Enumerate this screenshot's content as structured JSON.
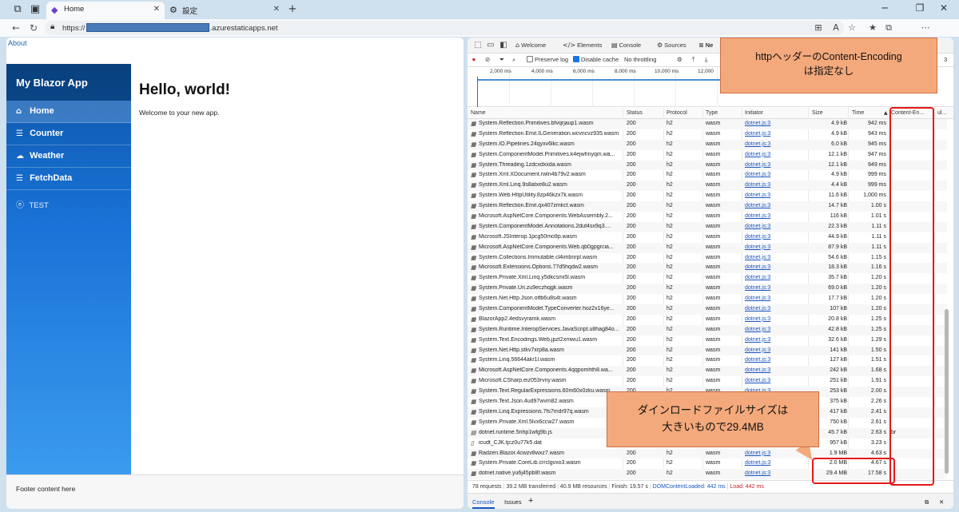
{
  "browser": {
    "tabs": [
      {
        "label": "Home",
        "icon": "blazor-icon"
      },
      {
        "label": "設定",
        "icon": "gear-icon"
      }
    ],
    "url_prefix": "https://",
    "url_suffix": ".azurestaticapps.net"
  },
  "app": {
    "about_link": "About",
    "brand": "My Blazor App",
    "nav": [
      {
        "label": "Home",
        "icon": "home-icon"
      },
      {
        "label": "Counter",
        "icon": "list-icon"
      },
      {
        "label": "Weather",
        "icon": "cloud-icon"
      },
      {
        "label": "FetchData",
        "icon": "list-icon"
      },
      {
        "label": "TEST",
        "icon": "circle-e-icon"
      }
    ],
    "heading": "Hello, world!",
    "welcome": "Welcome to your new app.",
    "footer": "Footer content here"
  },
  "devtools": {
    "tabs": [
      "Welcome",
      "Elements",
      "Console",
      "Sources",
      "Ne"
    ],
    "toolbar": {
      "preserve_log": "Preserve log",
      "disable_cache": "Disable cache",
      "throttling": "No throttling",
      "number": "3"
    },
    "timeline_ticks": [
      "2,000 ms",
      "4,000 ms",
      "6,000 ms",
      "8,000 ms",
      "10,000 ms",
      "12,000"
    ],
    "columns": [
      "Name",
      "Status",
      "Protocol",
      "Type",
      "Initiator",
      "Size",
      "Time",
      "Content-En...",
      "ul..."
    ],
    "rows": [
      {
        "name": "System.Reflection.Primitives.bfvqrjaup1.wasm",
        "status": "200",
        "protocol": "h2",
        "type": "wasm",
        "initiator": "dotnet.js:3",
        "size": "4.9 kB",
        "time": "942 ms"
      },
      {
        "name": "System.Reflection.Emit.ILGeneration.wcvncvz935.wasm",
        "status": "200",
        "protocol": "h2",
        "type": "wasm",
        "initiator": "dotnet.js:3",
        "size": "4.9 kB",
        "time": "943 ms"
      },
      {
        "name": "System.IO.Pipelines.24qyxv6lkc.wasm",
        "status": "200",
        "protocol": "h2",
        "type": "wasm",
        "initiator": "dotnet.js:3",
        "size": "6.0 kB",
        "time": "945 ms"
      },
      {
        "name": "System.ComponentModel.Primitives.k4ejwhnyqm.wa...",
        "status": "200",
        "protocol": "h2",
        "type": "wasm",
        "initiator": "dotnet.js:3",
        "size": "12.1 kB",
        "time": "947 ms"
      },
      {
        "name": "System.Threading.1zdcxdxxda.wasm",
        "status": "200",
        "protocol": "h2",
        "type": "wasm",
        "initiator": "dotnet.js:3",
        "size": "12.1 kB",
        "time": "949 ms"
      },
      {
        "name": "System.Xml.XDocument.rwln4b79v2.wasm",
        "status": "200",
        "protocol": "h2",
        "type": "wasm",
        "initiator": "dotnet.js:3",
        "size": "4.9 kB",
        "time": "999 ms"
      },
      {
        "name": "System.Xml.Linq.9s8atxe8u2.wasm",
        "status": "200",
        "protocol": "h2",
        "type": "wasm",
        "initiator": "dotnet.js:3",
        "size": "4.4 kB",
        "time": "999 ms"
      },
      {
        "name": "System.Web.HttpUtility.8zp46kzx7k.wasm",
        "status": "200",
        "protocol": "h2",
        "type": "wasm",
        "initiator": "dotnet.js:3",
        "size": "11.6 kB",
        "time": "1,000 ms"
      },
      {
        "name": "System.Reflection.Emit.qx407zmkct.wasm",
        "status": "200",
        "protocol": "h2",
        "type": "wasm",
        "initiator": "dotnet.js:3",
        "size": "14.7 kB",
        "time": "1.00 s"
      },
      {
        "name": "Microsoft.AspNetCore.Components.WebAssembly.2...",
        "status": "200",
        "protocol": "h2",
        "type": "wasm",
        "initiator": "dotnet.js:3",
        "size": "116 kB",
        "time": "1.01 s"
      },
      {
        "name": "System.ComponentModel.Annotations.2duf4sx9q3....",
        "status": "200",
        "protocol": "h2",
        "type": "wasm",
        "initiator": "dotnet.js:3",
        "size": "22.3 kB",
        "time": "1.11 s"
      },
      {
        "name": "Microsoft.JSInterop.1pcg50mo9p.wasm",
        "status": "200",
        "protocol": "h2",
        "type": "wasm",
        "initiator": "dotnet.js:3",
        "size": "44.9 kB",
        "time": "1.11 s"
      },
      {
        "name": "Microsoft.AspNetCore.Components.Web.qb0gpgrcia...",
        "status": "200",
        "protocol": "h2",
        "type": "wasm",
        "initiator": "dotnet.js:3",
        "size": "87.9 kB",
        "time": "1.11 s"
      },
      {
        "name": "System.Collections.Immutable.cl4imbnrpl.wasm",
        "status": "200",
        "protocol": "h2",
        "type": "wasm",
        "initiator": "dotnet.js:3",
        "size": "54.6 kB",
        "time": "1.15 s"
      },
      {
        "name": "Microsoft.Extensions.Options.77d5hqdw2.wasm",
        "status": "200",
        "protocol": "h2",
        "type": "wasm",
        "initiator": "dotnet.js:3",
        "size": "18.3 kB",
        "time": "1.16 s"
      },
      {
        "name": "System.Private.Xml.Linq.y5dkcsmi5l.wasm",
        "status": "200",
        "protocol": "h2",
        "type": "wasm",
        "initiator": "dotnet.js:3",
        "size": "35.7 kB",
        "time": "1.20 s"
      },
      {
        "name": "System.Private.Uri.zu9eczhqgk.wasm",
        "status": "200",
        "protocol": "h2",
        "type": "wasm",
        "initiator": "dotnet.js:3",
        "size": "69.0 kB",
        "time": "1.20 s"
      },
      {
        "name": "System.Net.Http.Json.otfb6u8s4t.wasm",
        "status": "200",
        "protocol": "h2",
        "type": "wasm",
        "initiator": "dotnet.js:3",
        "size": "17.7 kB",
        "time": "1.20 s"
      },
      {
        "name": "System.ComponentModel.TypeConverter.hoz2x16ye...",
        "status": "200",
        "protocol": "h2",
        "type": "wasm",
        "initiator": "dotnet.js:3",
        "size": "107 kB",
        "time": "1.20 s"
      },
      {
        "name": "BlazorApp2.4edsvyramk.wasm",
        "status": "200",
        "protocol": "h2",
        "type": "wasm",
        "initiator": "dotnet.js:3",
        "size": "20.8 kB",
        "time": "1.25 s"
      },
      {
        "name": "System.Runtime.InteropServices.JavaScript.u8hag84o...",
        "status": "200",
        "protocol": "h2",
        "type": "wasm",
        "initiator": "dotnet.js:3",
        "size": "42.8 kB",
        "time": "1.25 s"
      },
      {
        "name": "System.Text.Encodings.Web.jpzt2xmwu1.wasm",
        "status": "200",
        "protocol": "h2",
        "type": "wasm",
        "initiator": "dotnet.js:3",
        "size": "32.6 kB",
        "time": "1.29 s"
      },
      {
        "name": "System.Net.Http.stkv7xrp8a.wasm",
        "status": "200",
        "protocol": "h2",
        "type": "wasm",
        "initiator": "dotnet.js:3",
        "size": "141 kB",
        "time": "1.50 s"
      },
      {
        "name": "System.Linq.56644akr1l.wasm",
        "status": "200",
        "protocol": "h2",
        "type": "wasm",
        "initiator": "dotnet.js:3",
        "size": "127 kB",
        "time": "1.51 s"
      },
      {
        "name": "Microsoft.AspNetCore.Components.4qqpomhth8.wa...",
        "status": "200",
        "protocol": "h2",
        "type": "wasm",
        "initiator": "dotnet.js:3",
        "size": "242 kB",
        "time": "1.68 s"
      },
      {
        "name": "Microsoft.CSharp.eiz053rvny.wasm",
        "status": "200",
        "protocol": "h2",
        "type": "wasm",
        "initiator": "dotnet.js:3",
        "size": "251 kB",
        "time": "1.91 s"
      },
      {
        "name": "System.Text.RegularExpressions.60m60x0zku.wasm",
        "status": "200",
        "protocol": "h2",
        "type": "wasm",
        "initiator": "dotnet.js:3",
        "size": "253 kB",
        "time": "2.00 s"
      },
      {
        "name": "System.Text.Json.4ud97wvm82.wasm",
        "status": "200",
        "protocol": "h2",
        "type": "wasm",
        "initiator": "dotnet.js:3",
        "size": "375 kB",
        "time": "2.26 s"
      },
      {
        "name": "System.Linq.Expressions.7fs7mdr97q.wasm",
        "status": "200",
        "protocol": "h2",
        "type": "wasm",
        "initiator": "dotnet.js:3",
        "size": "417 kB",
        "time": "2.41 s"
      },
      {
        "name": "System.Private.Xml.5lvx6ccw27.wasm",
        "status": "200",
        "protocol": "h2",
        "type": "wasm",
        "initiator": "dotnet.js:3",
        "size": "750 kB",
        "time": "2.61 s"
      },
      {
        "name": "dotnet.runtime.5nhp1wfg9b.js",
        "status": "200",
        "protocol": "h2",
        "type": "script",
        "initiator": "dotnet.js:3",
        "size": "45.7 kB",
        "time": "2.63 s",
        "content_encoding": "br"
      },
      {
        "name": "icudt_CJK.tjcz0u77k5.dat",
        "status": "200",
        "protocol": "h2",
        "type": "fetch",
        "initiator": "dotnet.js:3",
        "size": "957 kB",
        "time": "3.23 s"
      },
      {
        "name": "Radzen.Blazor.4cwzv8wxz7.wasm",
        "status": "200",
        "protocol": "h2",
        "type": "wasm",
        "initiator": "dotnet.js:3",
        "size": "1.9 MB",
        "time": "4.63 s"
      },
      {
        "name": "System.Private.CoreLib.crrclgvxo3.wasm",
        "status": "200",
        "protocol": "h2",
        "type": "wasm",
        "initiator": "dotnet.js:3",
        "size": "2.0 MB",
        "time": "4.67 s"
      },
      {
        "name": "dotnet.native.yu6j45pb8f.wasm",
        "status": "200",
        "protocol": "h2",
        "type": "wasm",
        "initiator": "dotnet.js:3",
        "size": "29.4 MB",
        "time": "17.58 s"
      }
    ],
    "status": {
      "requests": "78 requests",
      "transferred": "39.2 MB transferred",
      "resources": "40.9 MB resources",
      "finish": "Finish: 19.57 s",
      "dcl": "DOMContentLoaded: 442 ms",
      "load": "Load: 442 ms"
    },
    "drawer_tabs": [
      "Console",
      "Issues"
    ]
  },
  "annotations": {
    "callout1": [
      "httpヘッダーのContent-Encoding",
      "は指定なし"
    ],
    "callout2": [
      "ダインロードファイルサイズは",
      "大きいもので29.4MB"
    ],
    "highlight_color": "#e61919",
    "callout_color": "#f3a97b"
  }
}
